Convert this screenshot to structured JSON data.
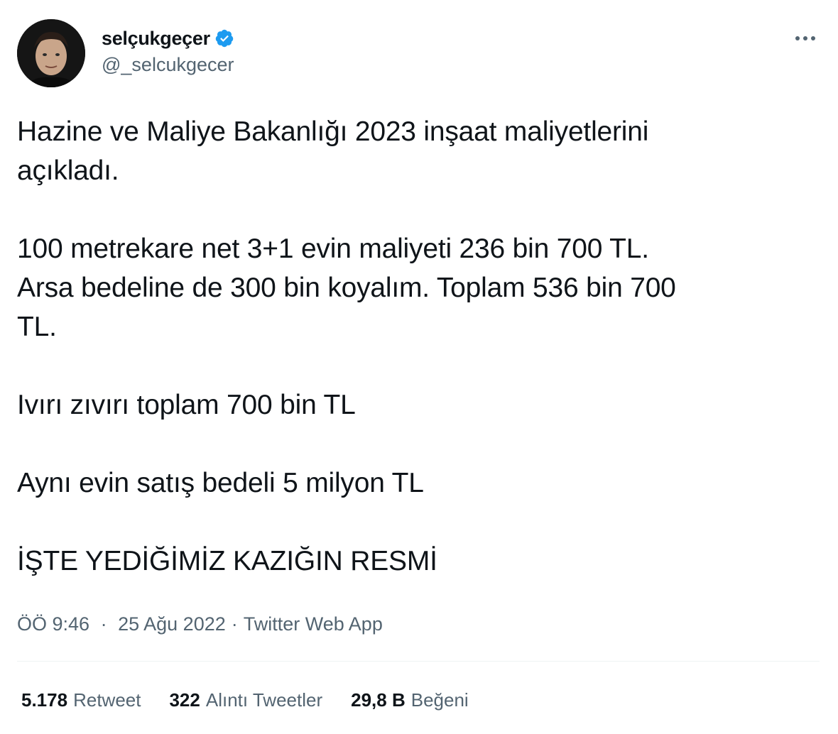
{
  "author": {
    "display_name": "selçukgeçer",
    "handle": "@_selcukgecer",
    "verified": true,
    "verified_icon": "verified-badge-icon",
    "avatar_icon": "avatar-photo"
  },
  "tweet": {
    "paragraphs": [
      [
        "Hazine ve Maliye Bakanlığı 2023 inşaat maliyetlerini",
        "açıkladı."
      ],
      [
        "100 metrekare net 3+1 evin maliyeti 236 bin 700 TL.",
        "Arsa bedeline de 300 bin koyalım. Toplam 536 bin 700",
        "TL."
      ],
      [
        "Ivırı zıvırı toplam 700 bin TL"
      ],
      [
        "Aynı evin satış bedeli 5 milyon TL"
      ],
      [
        "İŞTE YEDİĞİMİZ KAZIĞIN RESMİ"
      ]
    ]
  },
  "meta": {
    "time": "ÖÖ 9:46",
    "date": "25 Ağu 2022",
    "source": "Twitter Web App",
    "separator": "·"
  },
  "stats": {
    "retweets": {
      "value": "5.178",
      "label": "Retweet"
    },
    "quotes": {
      "value": "322",
      "label": "Alıntı Tweetler"
    },
    "likes": {
      "value": "29,8 B",
      "label": "Beğeni"
    }
  },
  "colors": {
    "text": "#0f1419",
    "secondary": "#536471",
    "verified": "#1d9bf0",
    "divider": "#eff3f4"
  },
  "icons": {
    "more": "more-horizontal-icon"
  }
}
